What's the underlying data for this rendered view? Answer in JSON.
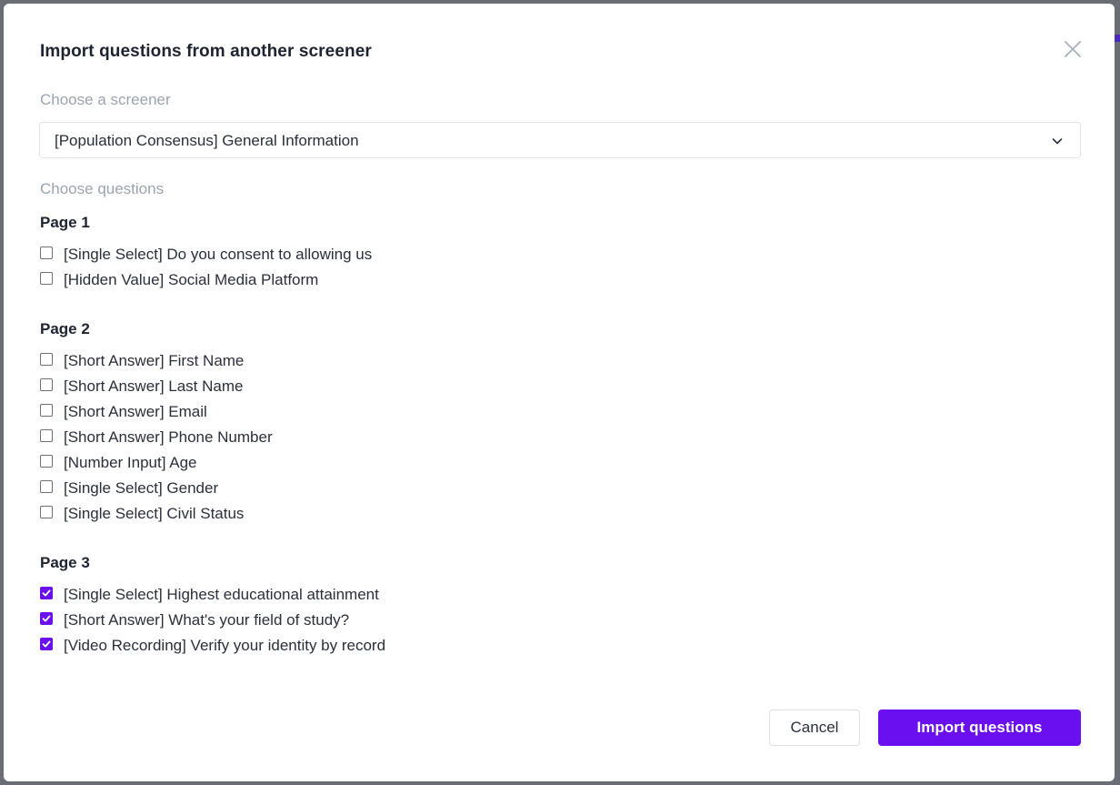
{
  "colors": {
    "accent": "#6a0ff0",
    "backdrop": "#6b6d75",
    "muted_label": "#9ca3af",
    "text": "#2b2f3a"
  },
  "dialog": {
    "title": "Import questions from another screener",
    "close_icon": "close-icon"
  },
  "screener": {
    "label": "Choose a screener",
    "selected": "[Population Consensus] General Information",
    "chevron_icon": "chevron-down-icon"
  },
  "questions": {
    "label": "Choose questions",
    "pages": [
      {
        "title": "Page 1",
        "items": [
          {
            "label": "[Single Select] Do you consent to allowing us",
            "checked": false
          },
          {
            "label": "[Hidden Value] Social Media Platform",
            "checked": false
          }
        ]
      },
      {
        "title": "Page 2",
        "items": [
          {
            "label": "[Short Answer] First Name",
            "checked": false
          },
          {
            "label": "[Short Answer] Last Name",
            "checked": false
          },
          {
            "label": "[Short Answer] Email",
            "checked": false
          },
          {
            "label": "[Short Answer] Phone Number",
            "checked": false
          },
          {
            "label": "[Number Input] Age",
            "checked": false
          },
          {
            "label": "[Single Select] Gender",
            "checked": false
          },
          {
            "label": "[Single Select] Civil Status",
            "checked": false
          }
        ]
      },
      {
        "title": "Page 3",
        "items": [
          {
            "label": "[Single Select] Highest educational attainment",
            "checked": true
          },
          {
            "label": "[Short Answer] What's your field of study?",
            "checked": true
          },
          {
            "label": "[Video Recording] Verify your identity by record",
            "checked": true
          }
        ]
      }
    ]
  },
  "footer": {
    "cancel_label": "Cancel",
    "import_label": "Import questions"
  }
}
